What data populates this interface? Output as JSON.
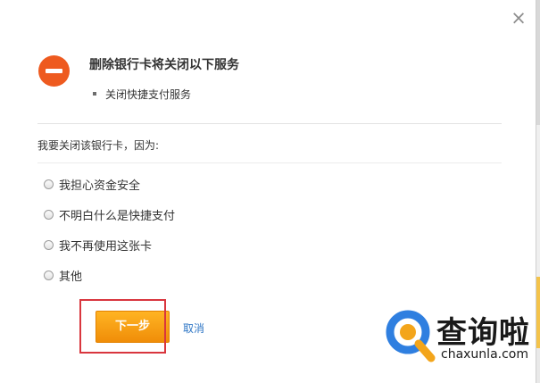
{
  "dialog": {
    "close_glyph": "×",
    "title": "删除银行卡将关闭以下服务",
    "service_item": "关闭快捷支付服务",
    "question": "我要关闭该银行卡，因为:",
    "options": [
      "我担心资金安全",
      "不明白什么是快捷支付",
      "我不再使用这张卡",
      "其他"
    ],
    "next_label": "下一步",
    "cancel_label": "取消"
  },
  "watermark": {
    "text": "查询啦",
    "url": "chaxunla.com"
  },
  "colors": {
    "warning": "#ee5a1f",
    "primary_button": "#f6a015",
    "link": "#3077c6",
    "highlight_box": "#d9363e",
    "watermark_blue": "#2f7fe0",
    "watermark_orange": "#f3a51b"
  }
}
